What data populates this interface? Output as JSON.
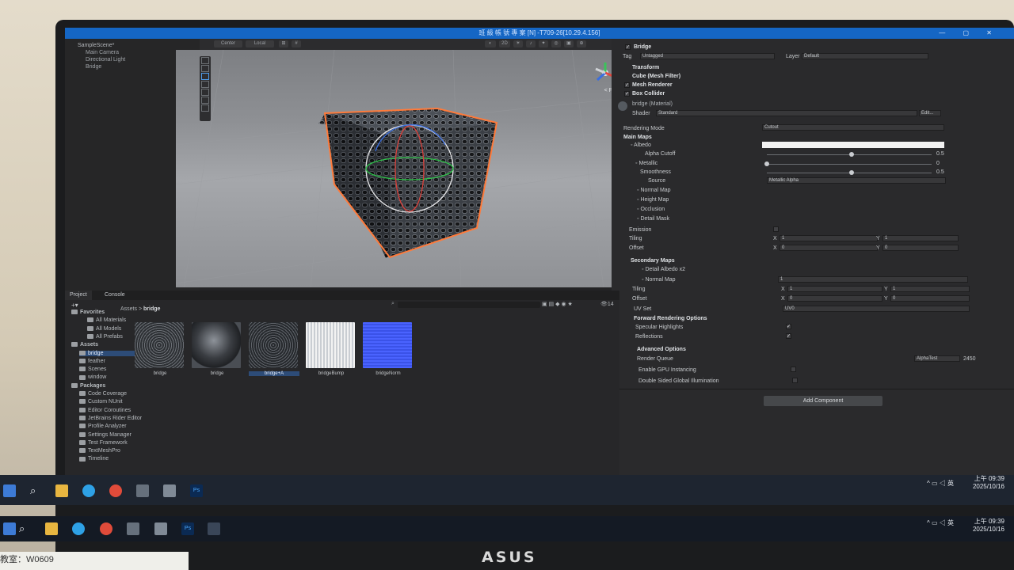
{
  "window": {
    "title": "班 級 帳 號 專 案 [N] -T709-26[10.29.4.156]"
  },
  "hierarchy": {
    "scene": "SampleScene*",
    "items": [
      "Main Camera",
      "Directional Light",
      "Bridge"
    ]
  },
  "toolbar": {
    "pivot": "Center",
    "space": "Local",
    "mode_2d": "2D"
  },
  "scene_view": {
    "projection_label": "< Persp"
  },
  "inspector": {
    "object_name": "Bridge",
    "tag_label": "Tag",
    "tag_value": "Untagged",
    "layer_label": "Layer",
    "layer_value": "Default",
    "components": [
      "Transform",
      "Cube (Mesh Filter)",
      "Mesh Renderer",
      "Box Collider"
    ],
    "material_name": "bridge (Material)",
    "shader_label": "Shader",
    "shader_value": "Standard",
    "edit_label": "Edit...",
    "rendering_mode_label": "Rendering Mode",
    "rendering_mode_value": "Cutout",
    "main_maps": "Main Maps",
    "albedo": "Albedo",
    "alpha_cutoff": "Alpha Cutoff",
    "alpha_cutoff_value": "0.5",
    "metallic": "Metallic",
    "metallic_value": "0",
    "smoothness": "Smoothness",
    "smoothness_value": "0.5",
    "source_label": "Source",
    "source_value": "Metallic Alpha",
    "normal_map": "Normal Map",
    "height_map": "Height Map",
    "occlusion": "Occlusion",
    "detail_mask": "Detail Mask",
    "emission": "Emission",
    "tiling": "Tiling",
    "offset": "Offset",
    "x": "X",
    "y": "Y",
    "tiling_x": "1",
    "tiling_y": "1",
    "offset_x": "0",
    "offset_y": "0",
    "secondary_maps": "Secondary Maps",
    "detail_albedo": "Detail Albedo x2",
    "sec_normal_map": "Normal Map",
    "sec_normal_value": "1",
    "sec_tiling_x": "1",
    "sec_tiling_y": "1",
    "sec_offset_x": "0",
    "sec_offset_y": "0",
    "uv_set": "UV Set",
    "uv_set_value": "UV0",
    "forward_options": "Forward Rendering Options",
    "specular_highlights": "Specular Highlights",
    "reflections": "Reflections",
    "advanced_options": "Advanced Options",
    "render_queue": "Render Queue",
    "render_queue_mode": "AlphaTest",
    "render_queue_value": "2450",
    "gpu_instancing": "Enable GPU Instancing",
    "double_sided_gi": "Double Sided Global Illumination",
    "add_component": "Add Component"
  },
  "project": {
    "tabs": [
      "Project",
      "Console"
    ],
    "breadcrumb_root": "Assets",
    "breadcrumb_sep": ">",
    "breadcrumb_current": "bridge",
    "hidden_count": "14",
    "tree": [
      {
        "label": "Favorites",
        "level": 0,
        "bold": true
      },
      {
        "label": "All Materials",
        "level": 2
      },
      {
        "label": "All Models",
        "level": 2
      },
      {
        "label": "All Prefabs",
        "level": 2
      },
      {
        "label": "Assets",
        "level": 0,
        "bold": true
      },
      {
        "label": "bridge",
        "level": 1,
        "selected": true
      },
      {
        "label": "feather",
        "level": 1
      },
      {
        "label": "Scenes",
        "level": 1
      },
      {
        "label": "window",
        "level": 1
      },
      {
        "label": "Packages",
        "level": 0,
        "bold": true
      },
      {
        "label": "Code Coverage",
        "level": 1
      },
      {
        "label": "Custom NUnit",
        "level": 1
      },
      {
        "label": "Editor Coroutines",
        "level": 1
      },
      {
        "label": "JetBrains Rider Editor",
        "level": 1
      },
      {
        "label": "Profile Analyzer",
        "level": 1
      },
      {
        "label": "Settings Manager",
        "level": 1
      },
      {
        "label": "Test Framework",
        "level": 1
      },
      {
        "label": "TextMeshPro",
        "level": 1
      },
      {
        "label": "Timeline",
        "level": 1
      }
    ],
    "assets": [
      {
        "name": "bridge",
        "kind": "texture"
      },
      {
        "name": "bridge",
        "kind": "material"
      },
      {
        "name": "bridge+A",
        "kind": "texture-alpha",
        "selected": true
      },
      {
        "name": "bridgeBump",
        "kind": "bump"
      },
      {
        "name": "bridgeNorm",
        "kind": "normal"
      }
    ]
  },
  "taskbar": {
    "time": "上午 09:39",
    "date": "2025/10/16",
    "ime": "英"
  },
  "desk_label": "教室：W0609",
  "brand": "ASUS",
  "colors": {
    "accent": "#1566c4",
    "selection": "#2d4c78",
    "outline": "#ff7a3a"
  }
}
